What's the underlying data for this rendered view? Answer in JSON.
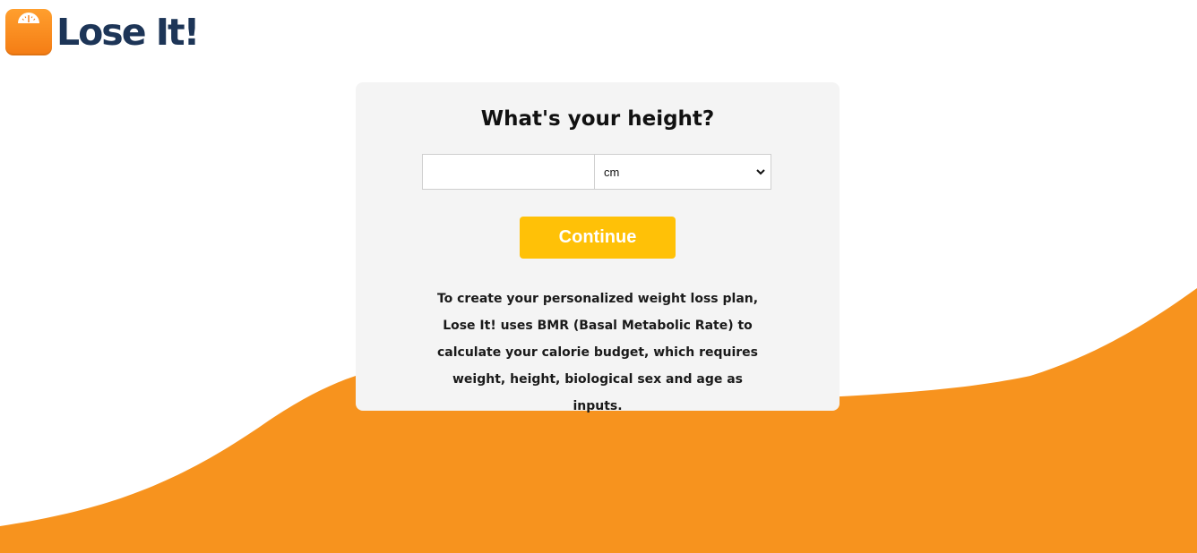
{
  "brand": {
    "name": "Lose It!",
    "logo_icon": "scale-icon",
    "text_color": "#1d3557",
    "icon_color": "#f7931e"
  },
  "form": {
    "title": "What's your height?",
    "height_input": {
      "value": "",
      "placeholder": ""
    },
    "unit_select": {
      "selected": "cm",
      "icon": "chevron-down-icon"
    },
    "continue_label": "Continue",
    "info": "To create your personalized weight loss plan, Lose It! uses BMR (Basal Metabolic Rate) to calculate your calorie budget, which requires weight, height, biological sex and age as inputs."
  },
  "colors": {
    "accent_wave": "#f7931e",
    "button": "#ffc107",
    "card_background": "#f4f4f4"
  }
}
